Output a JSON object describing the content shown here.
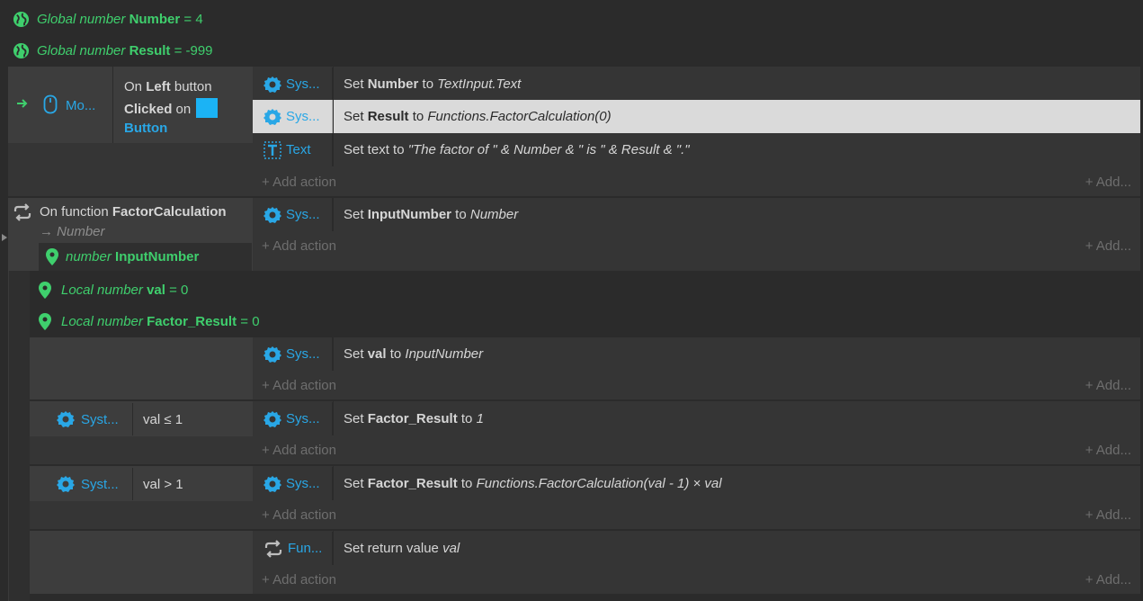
{
  "globals": [
    {
      "prefix": "Global number",
      "name": "Number",
      "eq": "= 4"
    },
    {
      "prefix": "Global number",
      "name": "Result",
      "eq": "= -999"
    }
  ],
  "event1": {
    "trigger_icon_label": "Mo...",
    "on": "On",
    "left": "Left",
    "button_word": "button",
    "clicked": "Clicked",
    "on2": "on",
    "object": "Button",
    "actions": [
      {
        "obj": "Sys...",
        "pre": "Set ",
        "b": "Number",
        "mid": " to ",
        "i": "TextInput.Text"
      },
      {
        "obj": "Sys...",
        "pre": "Set ",
        "b": "Result",
        "mid": " to ",
        "i": "Functions.FactorCalculation(0)"
      },
      {
        "obj": "Text",
        "pre": "Set text to ",
        "i": "\"The factor of \" & Number & \" is \" & Result & \".\""
      }
    ]
  },
  "event2": {
    "on_function": "On function",
    "name": "FactorCalculation",
    "returns": "→ Number",
    "param_prefix": "number",
    "param_name": "InputNumber",
    "actions": [
      {
        "obj": "Sys...",
        "pre": "Set ",
        "b": "InputNumber",
        "mid": " to ",
        "i": "Number"
      }
    ]
  },
  "locals": [
    {
      "prefix": "Local number",
      "name": "val",
      "eq": "= 0"
    },
    {
      "prefix": "Local number",
      "name": "Factor_Result",
      "eq": "= 0"
    }
  ],
  "sub1": {
    "actions": [
      {
        "obj": "Sys...",
        "pre": "Set ",
        "b": "val",
        "mid": " to ",
        "i": "InputNumber"
      }
    ]
  },
  "sub2": {
    "cond_obj": "Syst...",
    "cond": "val ≤ 1",
    "actions": [
      {
        "obj": "Sys...",
        "pre": "Set ",
        "b": "Factor_Result",
        "mid": " to ",
        "i": "1"
      }
    ]
  },
  "sub3": {
    "cond_obj": "Syst...",
    "cond": "val > 1",
    "actions": [
      {
        "obj": "Sys...",
        "pre": "Set ",
        "b": "Factor_Result",
        "mid": " to ",
        "i": "Functions.FactorCalculation(val - 1) × val"
      }
    ]
  },
  "sub4": {
    "actions": [
      {
        "obj": "Fun...",
        "pre": "Set return value ",
        "i": "val"
      }
    ]
  },
  "add_action": "Add action",
  "add_more": "Add...",
  "colors": {
    "green": "#3fcf6d",
    "blue": "#29a7e6",
    "selected": "#dadada"
  }
}
